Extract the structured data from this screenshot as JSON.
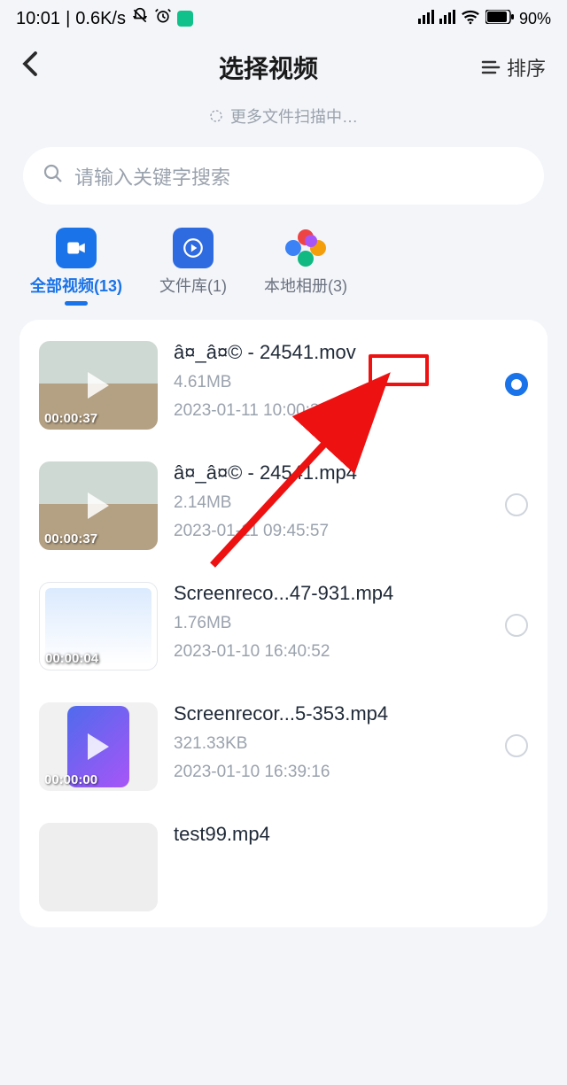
{
  "status": {
    "time": "10:01",
    "speed": "0.6K/s",
    "battery": "90%"
  },
  "header": {
    "title": "选择视频",
    "sort_label": "排序"
  },
  "scan_hint": "更多文件扫描中…",
  "search": {
    "placeholder": "请输入关键字搜索"
  },
  "tabs": [
    {
      "label": "全部视频(13)"
    },
    {
      "label": "文件库(1)"
    },
    {
      "label": "本地相册(3)"
    }
  ],
  "items": [
    {
      "name": "â¤_â¤© - 24541.mov",
      "size": "4.61MB",
      "date": "2023-01-11 10:00:39",
      "duration": "00:00:37",
      "selected": true
    },
    {
      "name": "â¤_â¤© - 24541.mp4",
      "size": "2.14MB",
      "date": "2023-01-11 09:45:57",
      "duration": "00:00:37",
      "selected": false
    },
    {
      "name": "Screenreco...47-931.mp4",
      "size": "1.76MB",
      "date": "2023-01-10 16:40:52",
      "duration": "00:00:04",
      "selected": false
    },
    {
      "name": "Screenrecor...5-353.mp4",
      "size": "321.33KB",
      "date": "2023-01-10 16:39:16",
      "duration": "00:00:00",
      "selected": false
    },
    {
      "name": "test99.mp4",
      "size": "",
      "date": "",
      "duration": "",
      "selected": false
    }
  ]
}
